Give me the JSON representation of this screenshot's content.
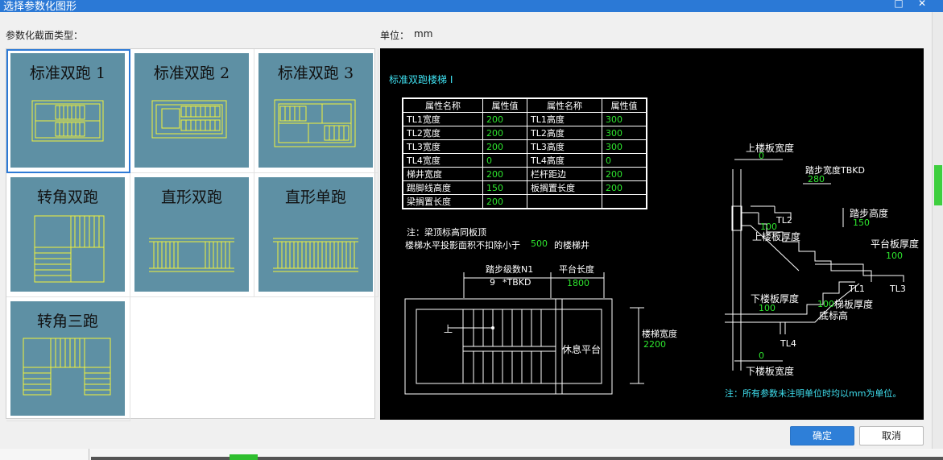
{
  "window": {
    "title": "选择参数化图形"
  },
  "labels": {
    "section_type": "参数化截面类型：",
    "unit_label": "单位：",
    "unit_value": "mm"
  },
  "shapes": [
    {
      "name": "标准双跑 1"
    },
    {
      "name": "标准双跑 2"
    },
    {
      "name": "标准双跑 3"
    },
    {
      "name": "转角双跑"
    },
    {
      "name": "直形双跑"
    },
    {
      "name": "直形单跑"
    },
    {
      "name": "转角三跑"
    }
  ],
  "preview": {
    "title": "标准双跑楼梯 I",
    "table": {
      "headers": [
        "属性名称",
        "属性值",
        "属性名称",
        "属性值"
      ],
      "rows": [
        [
          "TL1宽度",
          "200",
          "TL1高度",
          "300"
        ],
        [
          "TL2宽度",
          "200",
          "TL2高度",
          "300"
        ],
        [
          "TL3宽度",
          "200",
          "TL3高度",
          "300"
        ],
        [
          "TL4宽度",
          "0",
          "TL4高度",
          "0"
        ],
        [
          "梯井宽度",
          "200",
          "栏杆距边",
          "200"
        ],
        [
          "踢脚线高度",
          "150",
          "板搁置长度",
          "200"
        ],
        [
          "梁搁置长度",
          "200",
          "",
          ""
        ]
      ]
    },
    "note1": "注：梁顶标高同板顶",
    "note2_a": "楼梯水平投影面积不扣除小于",
    "note2_val": "500",
    "note2_b": "的楼梯井",
    "plan": {
      "steps_label": "踏步级数N1",
      "steps_value": "9",
      "steps_unit": "*TBKD",
      "landing_label": "平台长度",
      "landing_value": "1800",
      "up_label": "上",
      "rest_label": "休息平台",
      "width_label": "楼梯宽度",
      "width_value": "2200"
    },
    "section": {
      "top_slab_width_label": "上楼板宽度",
      "top_slab_width_value": "0",
      "tread_width_label": "踏步宽度TBKD",
      "tread_width_value": "280",
      "riser_label": "踏步高度",
      "riser_value": "150",
      "tl2": "TL2",
      "upper_slab_value": "100",
      "upper_slab_label": "上楼板厚度",
      "platform_label": "平台板厚度",
      "platform_value": "100",
      "tl1": "TL1",
      "tl3": "TL3",
      "lower_slab_label": "下楼板厚度",
      "lower_slab_value": "100",
      "stair_slab_value": "100",
      "stair_slab_label": "梯板厚度",
      "bottom_elev_label": "底标高",
      "tl4": "TL4",
      "bottom_slab_width_value": "0",
      "bottom_slab_width_label": "下楼板宽度"
    },
    "footer_note": "注：所有参数未注明单位时均以mm为单位。"
  },
  "buttons": {
    "ok": "确定",
    "cancel": "取消"
  },
  "colors": {
    "title_bar": "#2b79d6",
    "thumb_bg": "#5e90a4",
    "drawing_line": "#f2f23a",
    "preview_bg": "#000000",
    "value_green": "#2ee62e",
    "title_cyan": "#3fe0f0",
    "primary_button": "#2e7fd8"
  }
}
